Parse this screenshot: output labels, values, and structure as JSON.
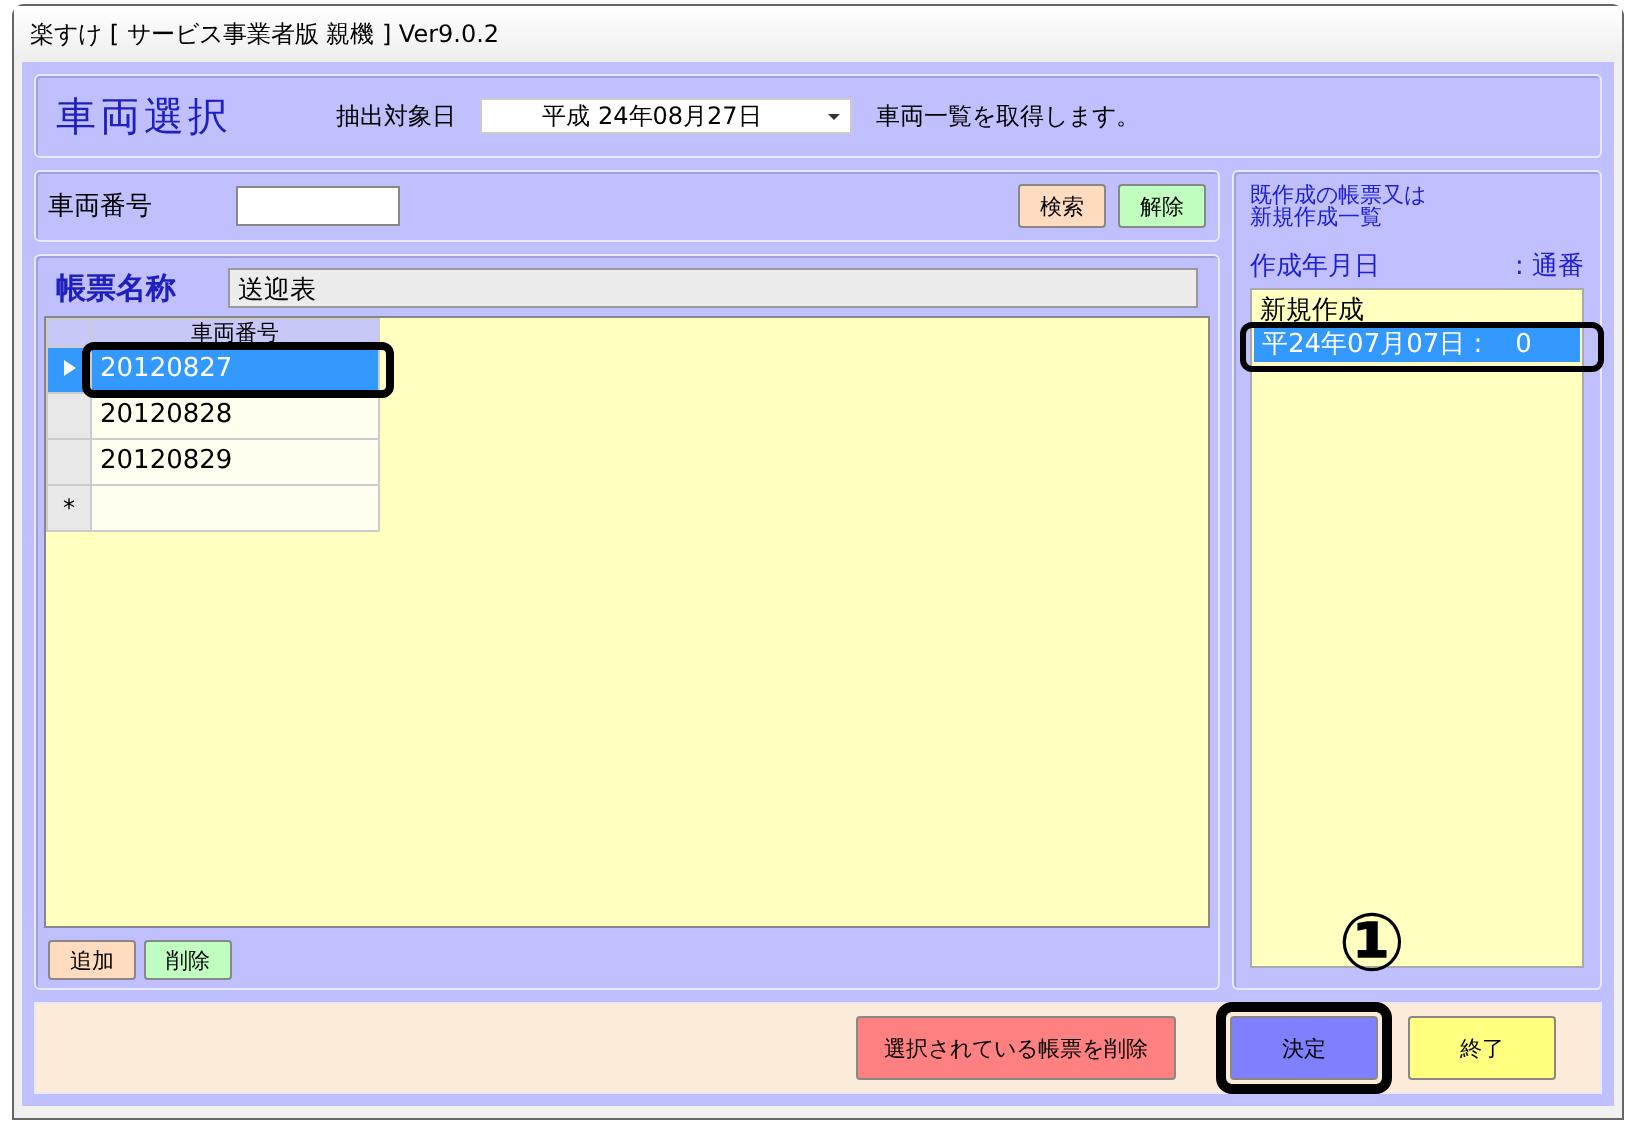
{
  "window": {
    "title": "楽すけ [ サービス事業者版 親機 ] Ver9.0.2"
  },
  "header": {
    "title": "車両選択",
    "date_label": "抽出対象日",
    "date_value": "平成  24年08月27日",
    "note": "車両一覧を取得します。"
  },
  "search": {
    "label": "車両番号",
    "buttons": [
      {
        "label": "検索",
        "kind": "search"
      },
      {
        "label": "解除",
        "kind": "clear"
      }
    ]
  },
  "form": {
    "label": "帳票名称",
    "value": "送迎表"
  },
  "grid": {
    "columns": [
      "車両番号"
    ],
    "rows": [
      {
        "value": "20120827",
        "selected": true
      },
      {
        "value": "20120828",
        "selected": false
      },
      {
        "value": "20120829",
        "selected": false
      },
      {
        "selected": false,
        "marker": "*"
      }
    ],
    "buttons": [
      {
        "label": "追加",
        "kind": "add"
      },
      {
        "label": "削除",
        "kind": "delete"
      }
    ]
  },
  "list": {
    "title_lines": [
      "既作成の帳票又は",
      "新規作成一覧"
    ],
    "columns": [
      "作成年月日",
      ": 通番"
    ],
    "items": [
      {
        "label": "新規作成",
        "selected": false
      },
      {
        "label": "平24年07月07日 :    0",
        "selected": true
      }
    ]
  },
  "footer": {
    "buttons": [
      {
        "label": "選択されている帳票を削除",
        "kind": "danger"
      },
      {
        "label": "決定",
        "kind": "primary"
      },
      {
        "label": "終了",
        "kind": "exit"
      }
    ]
  },
  "annotation": {
    "step": "①"
  }
}
